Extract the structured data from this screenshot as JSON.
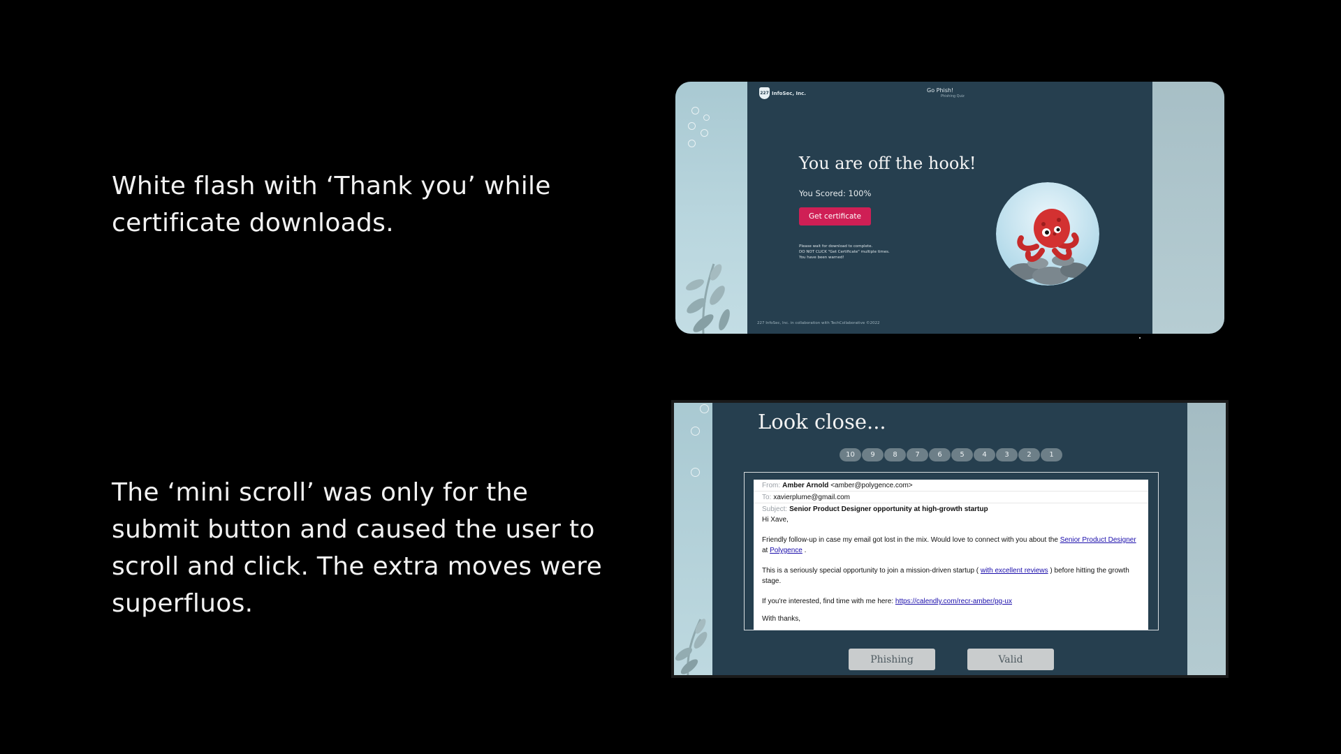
{
  "captions": [
    "White flash with ‘Thank you’ while certificate downloads.",
    "The ‘mini scroll’ was only for the submit button and caused the user to scroll and click. The extra moves were superfluos."
  ],
  "screen1": {
    "logo_badge": "227",
    "logo_text": "InfoSec, Inc.",
    "brand_title": "Go Phish!",
    "brand_subtitle": "Phishing Quiz",
    "heading": "You are off the hook!",
    "score": "You Scored: 100%",
    "certificate_button": "Get certificate",
    "warning_lines": [
      "Please wait for download to complete.",
      "DO NOT CLICK \"Get Certificate\" multiple times.",
      "You have been warned!"
    ],
    "footer": "227 InfoSec, Inc. in collaboration with TechCollaborative ©2022",
    "accent_color": "#cf1f55",
    "background_color": "#263f4f"
  },
  "screen2": {
    "heading": "Look close...",
    "countdown": [
      "10",
      "9",
      "8",
      "7",
      "6",
      "5",
      "4",
      "3",
      "2",
      "1"
    ],
    "email": {
      "from_label": "From:",
      "from_name": "Amber Arnold",
      "from_address": "<amber@polygence.com>",
      "to_label": "To:",
      "to_address": "xavierplume@gmail.com",
      "subject_label": "Subject:",
      "subject": "Senior Product Designer opportunity at high-growth startup",
      "greeting": "Hi Xave,",
      "p1_text": "Friendly follow-up in case my email got lost in the mix. Would love to connect with you about the",
      "p1_link1": "Senior Product Designer",
      "p1_mid": "at",
      "p1_link2": "Polygence",
      "p1_end": ".",
      "p2_text": "This is a seriously special opportunity to join a mission-driven startup (",
      "p2_link": "with excellent reviews",
      "p2_end": ") before hitting the growth stage.",
      "p3_text": "If you're interested, find time with me here:",
      "p3_link": "https://calendly.com/recr-amber/pg-ux",
      "signoff_partial": "With thanks,"
    },
    "phishing_button": "Phishing",
    "valid_button": "Valid"
  }
}
